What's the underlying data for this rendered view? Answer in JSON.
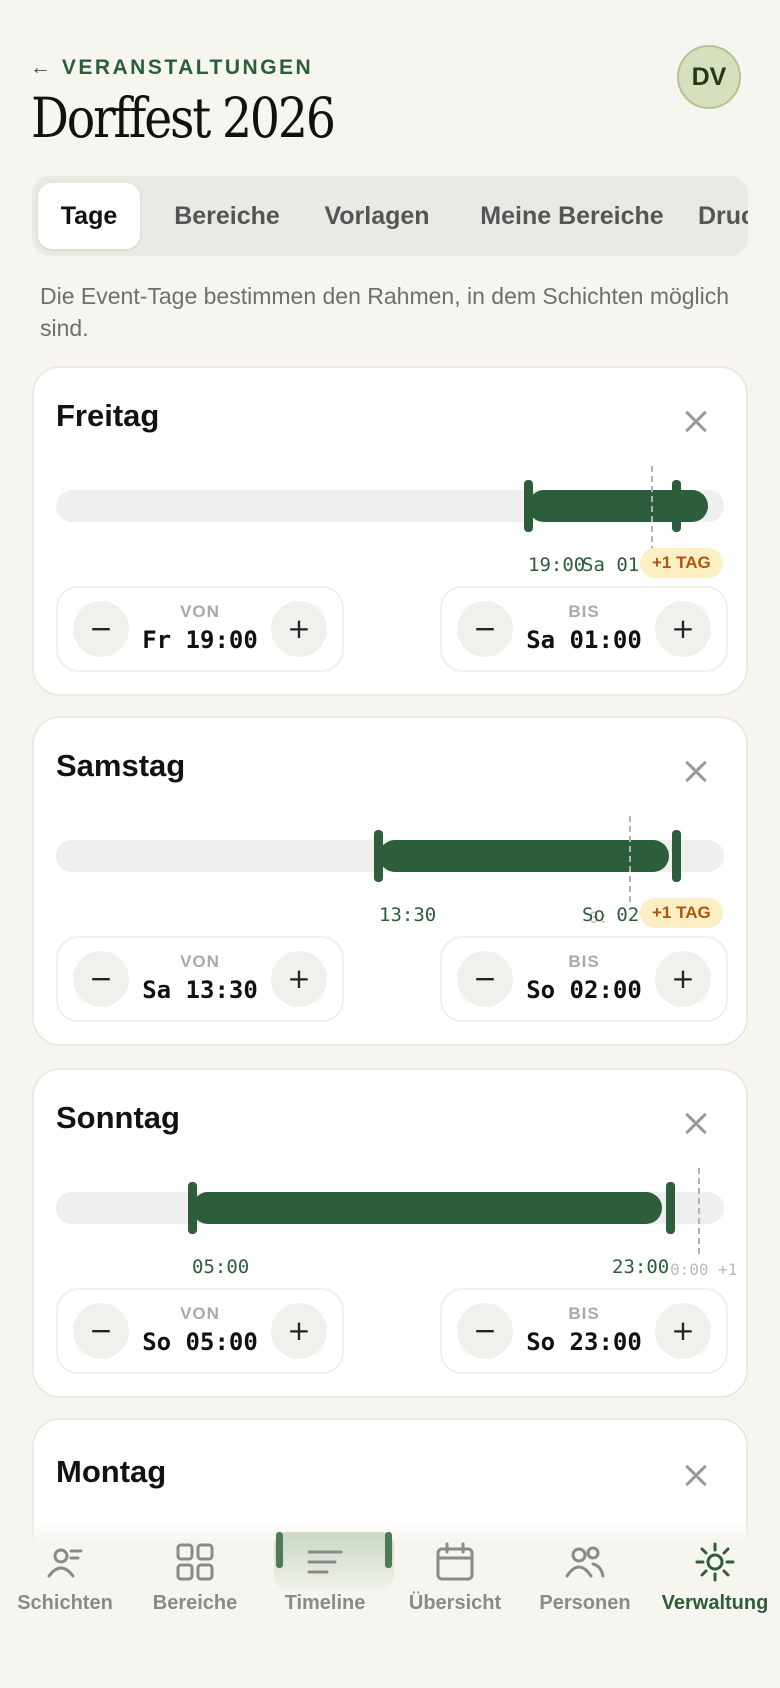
{
  "header": {
    "back_label": "← VERANSTALTUNGEN",
    "title": "Dorffest 2026",
    "avatar": "DV"
  },
  "tabs": [
    {
      "label": "Tage",
      "active": true
    },
    {
      "label": "Bereiche",
      "active": false
    },
    {
      "label": "Vorlagen",
      "active": false
    },
    {
      "label": "Meine Bereiche",
      "active": false
    },
    {
      "label": "Druc",
      "active": false
    }
  ],
  "intro": "Die Event-Tage bestimmen den Rahmen, in dem Schichten möglich sind.",
  "days": [
    {
      "name": "Freitag",
      "start_label": "19:00",
      "end_label": "Sa 01",
      "midnight_label": "00",
      "badge": "+1 TAG",
      "from_label": "VON",
      "from_value": "Fr 19:00",
      "to_label": "BIS",
      "to_value": "Sa 01:00"
    },
    {
      "name": "Samstag",
      "start_label": "13:30",
      "end_label": "So 02",
      "midnight_label": "0:",
      "badge": "+1 TAG",
      "from_label": "VON",
      "from_value": "Sa 13:30",
      "to_label": "BIS",
      "to_value": "So 02:00"
    },
    {
      "name": "Sonntag",
      "start_label": "05:00",
      "end_label": "23:00",
      "midnight_label": "0:00 +1",
      "from_label": "VON",
      "from_value": "So 05:00",
      "to_label": "BIS",
      "to_value": "So 23:00"
    },
    {
      "name": "Montag"
    }
  ],
  "stepper": {
    "minus": "−",
    "plus": "+"
  },
  "colors": {
    "accent": "#2c5e3b",
    "badge_bg": "#fcefc4",
    "badge_text": "#b15310",
    "background": "#f7f5ef"
  },
  "nav": [
    {
      "label": "Schichten",
      "icon": "shifts-icon",
      "active": false
    },
    {
      "label": "Bereiche",
      "icon": "grid-icon",
      "active": false
    },
    {
      "label": "Timeline",
      "icon": "timeline-icon",
      "active": false
    },
    {
      "label": "Übersicht",
      "icon": "calendar-icon",
      "active": false
    },
    {
      "label": "Personen",
      "icon": "people-icon",
      "active": false
    },
    {
      "label": "Verwaltung",
      "icon": "gear-icon",
      "active": true
    }
  ]
}
